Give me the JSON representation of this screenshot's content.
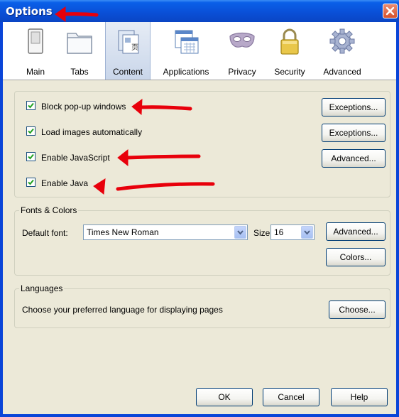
{
  "window": {
    "title": "Options",
    "close_icon": "close-icon"
  },
  "toolbar": {
    "tabs": [
      {
        "label": "Main",
        "icon": "switch-icon"
      },
      {
        "label": "Tabs",
        "icon": "folder-tabs-icon"
      },
      {
        "label": "Content",
        "icon": "content-page-icon",
        "selected": true
      },
      {
        "label": "Applications",
        "icon": "applications-icon"
      },
      {
        "label": "Privacy",
        "icon": "mask-icon"
      },
      {
        "label": "Security",
        "icon": "padlock-icon"
      },
      {
        "label": "Advanced",
        "icon": "gear-icon"
      }
    ]
  },
  "content_options": {
    "block_popups": {
      "label": "Block pop-up windows",
      "checked": true
    },
    "load_images": {
      "label": "Load images automatically",
      "checked": true
    },
    "enable_javascript": {
      "label": "Enable JavaScript",
      "checked": true
    },
    "enable_java": {
      "label": "Enable Java",
      "checked": true
    },
    "exceptions_popups_label": "Exceptions...",
    "exceptions_images_label": "Exceptions...",
    "advanced_js_label": "Advanced..."
  },
  "fonts_colors": {
    "title": "Fonts & Colors",
    "default_font_label": "Default font:",
    "default_font_value": "Times New Roman",
    "size_label": "Size:",
    "size_value": "16",
    "advanced_label": "Advanced...",
    "colors_label": "Colors..."
  },
  "languages": {
    "title": "Languages",
    "description": "Choose your preferred language for displaying pages",
    "choose_label": "Choose..."
  },
  "footer": {
    "ok_label": "OK",
    "cancel_label": "Cancel",
    "help_label": "Help"
  },
  "colors": {
    "titlebar": "#0a4fd6",
    "annotation_arrow": "#e8000b",
    "dialog_bg": "#ece9d8"
  }
}
